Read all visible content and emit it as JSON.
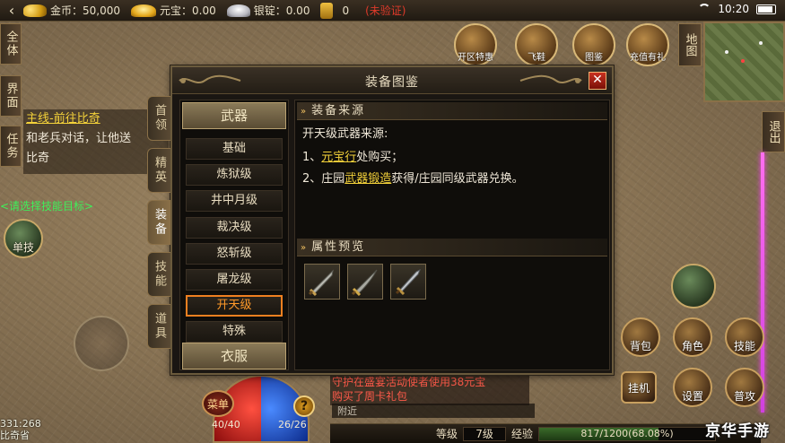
{
  "statusbar": {
    "back_icon": "back-arrow-icon",
    "gold_label": "金币：50,000",
    "yuanbao_label": "元宝：0.00",
    "silver_label": "银锭：0.00",
    "coin_value": "0",
    "unverified": "(未验证)",
    "time": "10:20"
  },
  "left_tabs": {
    "all": "全体",
    "ui": "界面",
    "task": "任务"
  },
  "quest": {
    "title": "主线-前往比奇",
    "body_line1": "和老兵对话，让他送",
    "body_line2": "比奇"
  },
  "skill_hint": "<请选择技能目标>",
  "skill_button": "单技",
  "top_buttons": {
    "kaiqu": "开区特惠",
    "fly": "飞鞋",
    "tujian": "图鉴",
    "charge": "充值有礼",
    "map": "地图"
  },
  "exit_button": "退出",
  "dialog": {
    "title": "装备图鉴",
    "close": "✕",
    "side_tabs": [
      "首领",
      "精英",
      "装备",
      "技能",
      "道具"
    ],
    "active_side_tab": "装备",
    "category_weapon": "武器",
    "category_clothes": "衣服",
    "sub_items": [
      "基础",
      "炼狱级",
      "井中月级",
      "裁决级",
      "怒斩级",
      "屠龙级",
      "开天级",
      "特殊"
    ],
    "selected_sub_item": "开天级",
    "source_header": "装备来源",
    "source_intro": "开天级武器来源:",
    "source_line1_prefix": "1、",
    "source_line1_link": "元宝行",
    "source_line1_suffix": "处购买；",
    "source_line2_prefix": "2、庄园",
    "source_line2_link": "武器锻造",
    "source_line2_suffix": "获得/庄园同级武器兑换。",
    "preview_header": "属性预览",
    "preview_items": [
      "sword-icon",
      "blade-icon",
      "sword-icon"
    ]
  },
  "right_buttons": {
    "bag": "背包",
    "role": "角色",
    "skill": "技能",
    "setting": "设置",
    "guaji": "挂机",
    "attack": "普攻"
  },
  "chat": {
    "line1": "守护在盛宴活动使者使用38元宝",
    "line2": "购买了周卡礼包",
    "nearby": "附近"
  },
  "hud": {
    "menu": "菜单",
    "hp": "40/40",
    "mp": "26/26",
    "help": "?",
    "level_label": "等级",
    "level_value": "7级",
    "exp_label": "经验",
    "exp_value": "817/1200(68.08%)",
    "exp_fraction": 0.6808,
    "coords_line1": "331:268",
    "coords_line2": "比奇省"
  },
  "watermark": "京华手游",
  "colors": {
    "link_yellow": "#f4d23a",
    "selected_orange": "#f08020",
    "quest_green": "#3ef05a",
    "chat_red": "#ff5a4a"
  }
}
